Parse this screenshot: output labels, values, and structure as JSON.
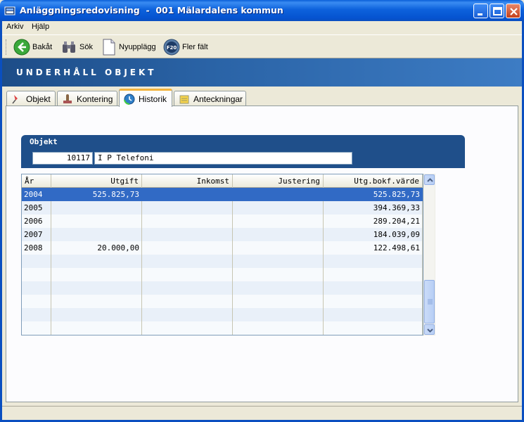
{
  "window": {
    "title": "Anläggningsredovisning  -  001 Mälardalens kommun"
  },
  "menu": {
    "items": [
      {
        "label": "Arkiv"
      },
      {
        "label": "Hjälp"
      }
    ]
  },
  "toolbar": {
    "back_label": "Bakåt",
    "search_label": "Sök",
    "new_label": "Nyupplägg",
    "more_fields_label": "Fler fält",
    "more_fields_key": "F20"
  },
  "banner": {
    "title": "UNDERHÅLL OBJEKT"
  },
  "tabs": [
    {
      "label": "Objekt",
      "active": false
    },
    {
      "label": "Kontering",
      "active": false
    },
    {
      "label": "Historik",
      "active": true
    },
    {
      "label": "Anteckningar",
      "active": false
    }
  ],
  "objekt": {
    "label": "Objekt",
    "id": "10117",
    "name": "I P Telefoni"
  },
  "grid": {
    "columns": [
      "År",
      "Utgift",
      "Inkomst",
      "Justering",
      "Utg.bokf.värde"
    ],
    "rows": [
      {
        "year": "2004",
        "utgift": "525.825,73",
        "inkomst": "",
        "justering": "",
        "bokf": "525.825,73"
      },
      {
        "year": "2005",
        "utgift": "",
        "inkomst": "",
        "justering": "",
        "bokf": "394.369,33"
      },
      {
        "year": "2006",
        "utgift": "",
        "inkomst": "",
        "justering": "",
        "bokf": "289.204,21"
      },
      {
        "year": "2007",
        "utgift": "",
        "inkomst": "",
        "justering": "",
        "bokf": "184.039,09"
      },
      {
        "year": "2008",
        "utgift": "20.000,00",
        "inkomst": "",
        "justering": "",
        "bokf": "122.498,61"
      }
    ],
    "selected_row": 0
  },
  "colors": {
    "banner": "#2a63a6",
    "selection": "#316ac5",
    "titlebar": "#0553d0"
  }
}
